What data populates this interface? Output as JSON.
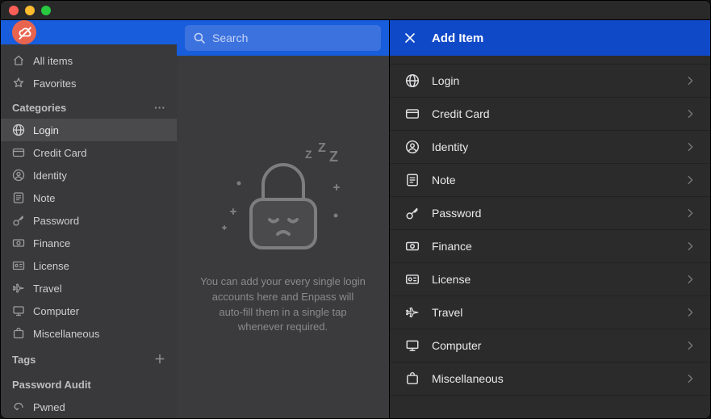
{
  "search": {
    "placeholder": "Search"
  },
  "sidebar": {
    "all_items": "All items",
    "favorites": "Favorites",
    "hdr_categories": "Categories",
    "hdr_tags": "Tags",
    "hdr_audit": "Password Audit",
    "pwned": "Pwned",
    "cats": {
      "login": "Login",
      "credit_card": "Credit Card",
      "identity": "Identity",
      "note": "Note",
      "password": "Password",
      "finance": "Finance",
      "license": "License",
      "travel": "Travel",
      "computer": "Computer",
      "misc": "Miscellaneous"
    }
  },
  "empty": {
    "msg": "You can add your every single login accounts here and Enpass will auto-fill them in a single tap whenever required."
  },
  "panel": {
    "title": "Add Item",
    "items": {
      "login": "Login",
      "credit_card": "Credit Card",
      "identity": "Identity",
      "note": "Note",
      "password": "Password",
      "finance": "Finance",
      "license": "License",
      "travel": "Travel",
      "computer": "Computer",
      "misc": "Miscellaneous"
    }
  }
}
